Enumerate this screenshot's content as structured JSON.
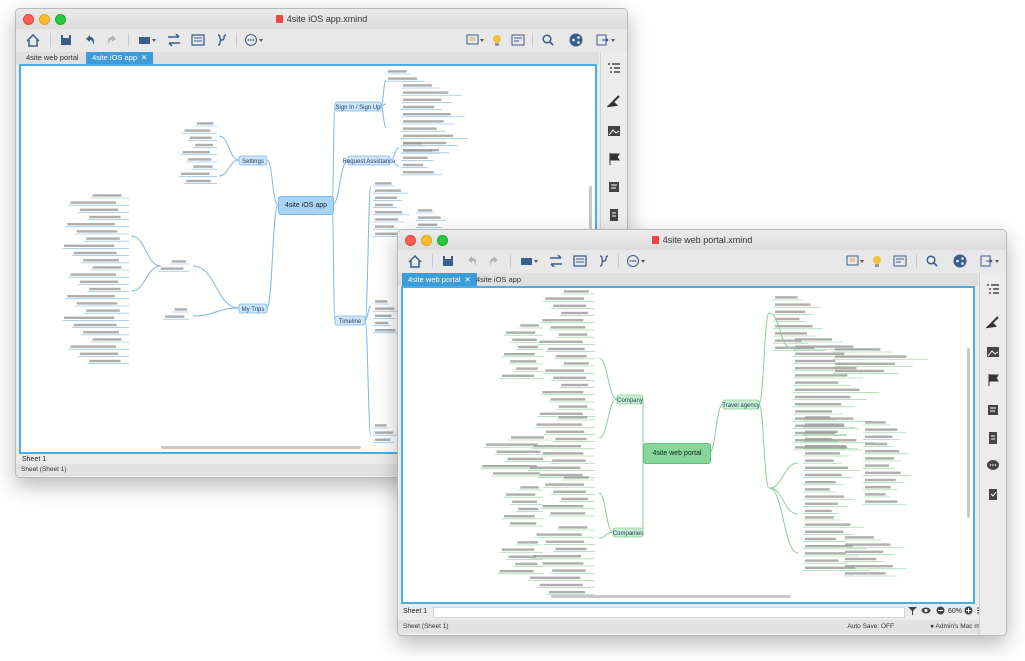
{
  "back_window": {
    "title": "4site iOS app.xmind",
    "tabs": [
      {
        "label": "4site web portal",
        "active": false
      },
      {
        "label": "4site iOS app",
        "active": true,
        "close": "✕"
      }
    ],
    "central_topic": "4site iOS app",
    "main_topics": [
      "Sign In / Sign Up",
      "Settings",
      "Request Assistance",
      "My Trips",
      "Timeline"
    ],
    "sheet_tab": "Sheet 1",
    "status": "Sheet (Sheet 1)"
  },
  "front_window": {
    "title": "4site web portal.xmind",
    "tabs": [
      {
        "label": "4site web portal",
        "active": true,
        "close": "✕"
      },
      {
        "label": "4site iOS app",
        "active": false
      }
    ],
    "central_topic": "4site web portal",
    "main_topics": [
      "Travel agency",
      "Company",
      "Companies"
    ],
    "sheet_tab": "Sheet 1",
    "zoom": "60%",
    "status": "Sheet (Sheet 1)",
    "autosave": "Auto Save: OFF",
    "user": "Admin's Mac mini (2)"
  },
  "colors": {
    "accent_blue": "#49aee6",
    "topic_blue": "#a9d4f5",
    "topic_green": "#86d79a",
    "branch_blue": "#7bb8e8",
    "branch_green": "#8ccf9c"
  },
  "icons": [
    "home-icon",
    "save-icon",
    "undo-icon",
    "redo-icon",
    "structure-icon",
    "relationship-icon",
    "summary-icon",
    "boundary-icon",
    "more-icon",
    "presentation-icon",
    "idea-icon",
    "gantt-icon",
    "search-icon",
    "share-icon",
    "export-icon",
    "outline-icon",
    "format-icon",
    "image-icon",
    "flag-icon",
    "notes-icon",
    "comment-icon",
    "task-icon",
    "filter-icon",
    "eye-icon",
    "zoom-out-icon",
    "zoom-in-icon",
    "menu-icon"
  ]
}
